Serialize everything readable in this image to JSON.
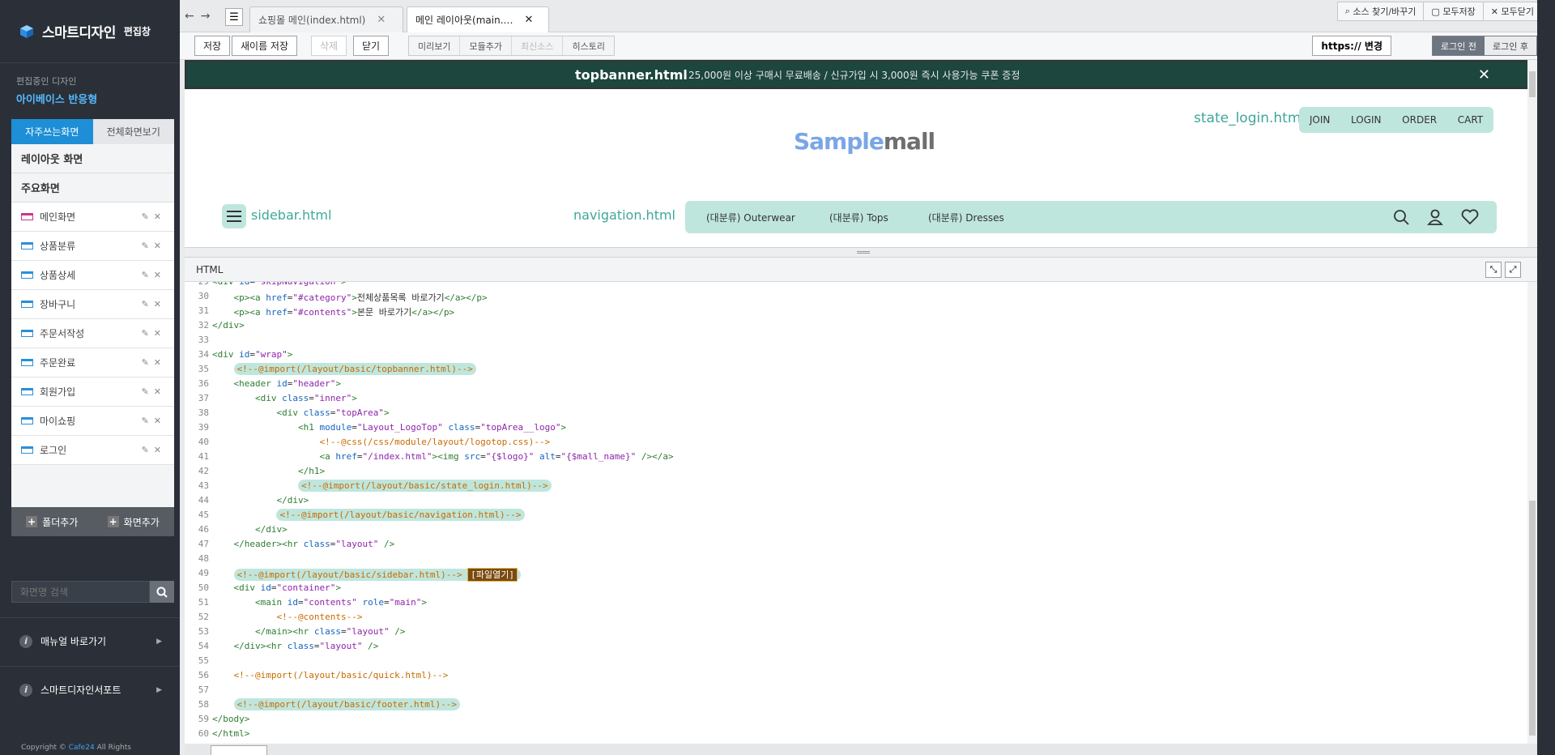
{
  "sidebar": {
    "title": "스마트디자인",
    "subtitle": "편집창",
    "current_label": "편집중인 디자인",
    "current_name": "아이베이스 반응형",
    "tabs": [
      "자주쓰는화면",
      "전체화면보기"
    ],
    "section_layout": "레이아웃 화면",
    "section_main": "주요화면",
    "items": [
      {
        "label": "메인화면"
      },
      {
        "label": "상품분류"
      },
      {
        "label": "상품상세"
      },
      {
        "label": "장바구니"
      },
      {
        "label": "주문서작성"
      },
      {
        "label": "주문완료"
      },
      {
        "label": "회원가입"
      },
      {
        "label": "마이쇼핑"
      },
      {
        "label": "로그인"
      }
    ],
    "add_folder": "폴더추가",
    "add_screen": "화면추가",
    "search_placeholder": "화면명 검색",
    "menu_manual": "매뉴얼 바로가기",
    "menu_support": "스마트디자인서포트",
    "copyright_prefix": "Copyright ©",
    "copyright_brand": "Cafe24",
    "copyright_suffix": "All Rights"
  },
  "topbar": {
    "tab1": "쇼핑몰 메인(index.html)",
    "tab2": "메인 레이아웃(main.…",
    "find_replace": "소스 찾기/바꾸기",
    "save_all": "모두저장",
    "close_all": "모두닫기"
  },
  "toolbar": {
    "save": "저장",
    "save_as": "새이름 저장",
    "delete": "삭제",
    "close": "닫기",
    "preview": "미리보기",
    "add_module": "모듈추가",
    "restore": "최신소스",
    "history": "히스토리",
    "https": "https:// 변경",
    "login_before": "로그인 전",
    "login_after": "로그인 후"
  },
  "preview": {
    "topbanner_file": "topbanner.html",
    "topbanner_text": "25,000원 이상 구매시 무료배송 / 신규가입 시 3,000원 즉시 사용가능 쿠폰 증정",
    "state_login_file": "state_login.html",
    "util_links": [
      "JOIN",
      "LOGIN",
      "ORDER",
      "CART"
    ],
    "logo_part1": "Sample",
    "logo_part2": "mall",
    "sidebar_file": "sidebar.html",
    "navigation_file": "navigation.html",
    "categories": [
      "(대분류) Outerwear",
      "(대분류) Tops",
      "(대분류) Dresses"
    ]
  },
  "code": {
    "panel_title": "HTML",
    "open_file_label": "[파일열기]",
    "first_visible_line": 29,
    "colors": {
      "tag": "#2e7d32",
      "attr": "#1565c0",
      "string": "#8e24aa",
      "comment": "#c76b00",
      "highlight": "#bfe6dd"
    }
  }
}
